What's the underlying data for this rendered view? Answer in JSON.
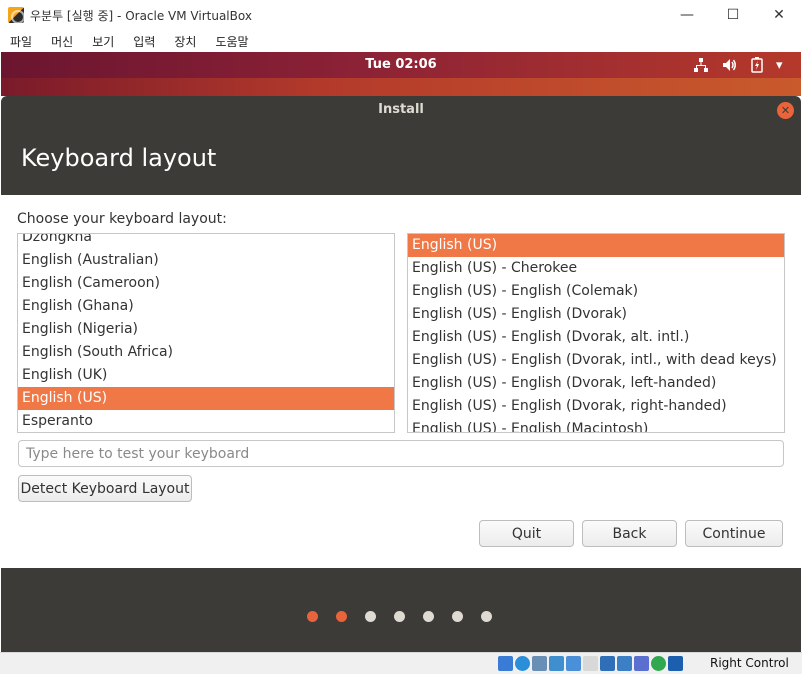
{
  "host": {
    "window_title": "우분투 [실행 중] - Oracle VM VirtualBox",
    "controls": {
      "minimize": "—",
      "maximize": "☐",
      "close": "✕"
    },
    "menu": [
      "파일",
      "머신",
      "보기",
      "입력",
      "장치",
      "도움말"
    ],
    "status_label": "Right Control"
  },
  "desktop": {
    "clock": "Tue 02:06",
    "tray": {
      "network_glyph": "⊞",
      "volume_glyph": "◀)",
      "battery_glyph": "▮",
      "menu_arrow": "▾"
    }
  },
  "installer": {
    "window_title": "Install",
    "close_glyph": "✕",
    "heading": "Keyboard layout",
    "prompt": "Choose your keyboard layout:",
    "layouts": [
      "Dzongkha",
      "English (Australian)",
      "English (Cameroon)",
      "English (Ghana)",
      "English (Nigeria)",
      "English (South Africa)",
      "English (UK)",
      "English (US)",
      "Esperanto"
    ],
    "selected_layout": "English (US)",
    "variants": [
      "English (US)",
      "English (US) - Cherokee",
      "English (US) - English (Colemak)",
      "English (US) - English (Dvorak)",
      "English (US) - English (Dvorak, alt. intl.)",
      "English (US) - English (Dvorak, intl., with dead keys)",
      "English (US) - English (Dvorak, left-handed)",
      "English (US) - English (Dvorak, right-handed)",
      "English (US) - English (Macintosh)"
    ],
    "selected_variant": "English (US)",
    "test_placeholder": "Type here to test your keyboard",
    "detect_button": "Detect Keyboard Layout",
    "quit_button": "Quit",
    "back_button": "Back",
    "continue_button": "Continue",
    "progress": {
      "total_steps": 7,
      "completed_steps": 2
    }
  },
  "colors": {
    "accent": "#f07746",
    "dark_panel": "#3c3b37",
    "dot_inactive": "#dfdbd2"
  }
}
